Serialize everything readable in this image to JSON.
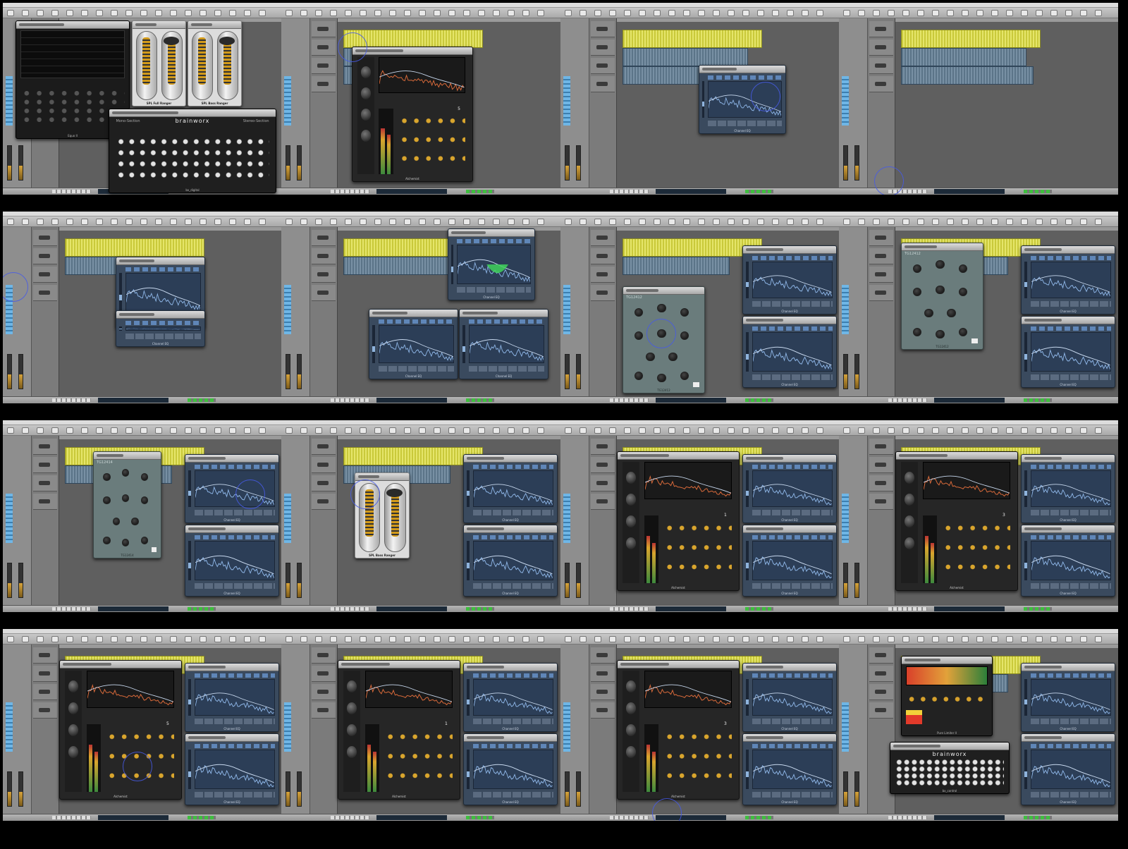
{
  "grid": {
    "columns": 4,
    "rows": 4
  },
  "frames": [
    {
      "id": "f1",
      "clips": [],
      "plugins": [
        {
          "kind": "eq3",
          "label": "Equo II",
          "box": "a"
        },
        {
          "kind": "spl",
          "label": "SPL Full Ranger",
          "box": "b"
        },
        {
          "kind": "spl",
          "label": "SPL Bass Ranger",
          "box": "c"
        },
        {
          "kind": "bwx",
          "label": "bx_digital",
          "brand": "brainworx",
          "left": "Mono-Section",
          "right": "Stereo-Section",
          "box": "d"
        }
      ],
      "cursor": null
    },
    {
      "id": "f2",
      "clips": [
        "y1",
        "b1",
        "b2"
      ],
      "plugins": [
        {
          "kind": "alch",
          "label": "Alchemist",
          "num": "5",
          "box": "e"
        }
      ],
      "cursor": "c2"
    },
    {
      "id": "f3",
      "clips": [
        "y2",
        "b3",
        "b4"
      ],
      "plugins": [
        {
          "kind": "chEQ",
          "label": "Channel EQ",
          "box": "f"
        }
      ],
      "cursor": "c3"
    },
    {
      "id": "f4",
      "clips": [
        "y2",
        "b3",
        "b4"
      ],
      "plugins": [],
      "cursor": "c4"
    },
    {
      "id": "f5",
      "clips": [
        "y3",
        "b5"
      ],
      "plugins": [
        {
          "kind": "chEQ",
          "label": "Channel EQ",
          "box": "g"
        },
        {
          "kind": "chEQ",
          "label": "Channel EQ",
          "box": "g2"
        }
      ],
      "cursor": "c5"
    },
    {
      "id": "f6",
      "clips": [
        "y3",
        "b5"
      ],
      "plugins": [
        {
          "kind": "chEQ",
          "label": "Channel EQ",
          "box": "h",
          "green": true
        },
        {
          "kind": "chEQ",
          "label": "Channel EQ",
          "box": "h2"
        },
        {
          "kind": "chEQ",
          "label": "Channel EQ",
          "box": "h3"
        }
      ],
      "cursor": null
    },
    {
      "id": "f7",
      "clips": [
        "y3",
        "b5"
      ],
      "plugins": [
        {
          "kind": "tg",
          "label": "TG12412",
          "box": "i"
        },
        {
          "kind": "chEQ",
          "label": "Channel EQ",
          "box": "r1"
        },
        {
          "kind": "chEQ",
          "label": "Channel EQ",
          "box": "r2"
        }
      ],
      "cursor": "c7"
    },
    {
      "id": "f8",
      "clips": [
        "y3",
        "b5"
      ],
      "plugins": [
        {
          "kind": "tg",
          "label": "TG12412",
          "box": "j"
        },
        {
          "kind": "chEQ",
          "label": "Channel EQ",
          "box": "r1"
        },
        {
          "kind": "chEQ",
          "label": "Channel EQ",
          "box": "r2"
        }
      ],
      "cursor": null
    },
    {
      "id": "f9",
      "clips": [
        "y3",
        "b5"
      ],
      "plugins": [
        {
          "kind": "tg",
          "label": "TG12414",
          "box": "k"
        },
        {
          "kind": "chEQ",
          "label": "Channel EQ",
          "box": "r1"
        },
        {
          "kind": "chEQ",
          "label": "Channel EQ",
          "box": "r2"
        }
      ],
      "cursor": "c9"
    },
    {
      "id": "f10",
      "clips": [
        "y3",
        "b5"
      ],
      "plugins": [
        {
          "kind": "spl",
          "label": "SPL Bass Ranger",
          "box": "l"
        },
        {
          "kind": "chEQ",
          "label": "Channel EQ",
          "box": "r1"
        },
        {
          "kind": "chEQ",
          "label": "Channel EQ",
          "box": "r2"
        }
      ],
      "cursor": "c10"
    },
    {
      "id": "f11",
      "clips": [
        "y3",
        "b5"
      ],
      "plugins": [
        {
          "kind": "alch",
          "label": "Alchemist",
          "num": "1",
          "box": "m"
        },
        {
          "kind": "chEQ",
          "label": "Channel EQ",
          "box": "r1"
        },
        {
          "kind": "chEQ",
          "label": "Channel EQ",
          "box": "r2"
        }
      ],
      "cursor": null
    },
    {
      "id": "f12",
      "clips": [
        "y3",
        "b5"
      ],
      "plugins": [
        {
          "kind": "alch",
          "label": "Alchemist",
          "num": "3",
          "box": "m"
        },
        {
          "kind": "chEQ",
          "label": "Channel EQ",
          "box": "r1"
        },
        {
          "kind": "chEQ",
          "label": "Channel EQ",
          "box": "r2"
        }
      ],
      "cursor": null
    },
    {
      "id": "f13",
      "clips": [
        "y3",
        "b5"
      ],
      "plugins": [
        {
          "kind": "alch",
          "label": "Alchemist",
          "num": "5",
          "box": "m"
        },
        {
          "kind": "chEQ",
          "label": "Channel EQ",
          "box": "r1"
        },
        {
          "kind": "chEQ",
          "label": "Channel EQ",
          "box": "r2"
        }
      ],
      "cursor": "c13"
    },
    {
      "id": "f14",
      "clips": [
        "y3",
        "b5"
      ],
      "plugins": [
        {
          "kind": "alch",
          "label": "Alchemist",
          "num": "1",
          "box": "m"
        },
        {
          "kind": "chEQ",
          "label": "Channel EQ",
          "box": "r1"
        },
        {
          "kind": "chEQ",
          "label": "Channel EQ",
          "box": "r2"
        }
      ],
      "cursor": null
    },
    {
      "id": "f15",
      "clips": [
        "y3",
        "b5"
      ],
      "plugins": [
        {
          "kind": "alch",
          "label": "Alchemist",
          "num": "3",
          "box": "m"
        },
        {
          "kind": "chEQ",
          "label": "Channel EQ",
          "box": "r1"
        },
        {
          "kind": "chEQ",
          "label": "Channel EQ",
          "box": "r2"
        }
      ],
      "cursor": "c15"
    },
    {
      "id": "f16",
      "clips": [
        "y3",
        "b5"
      ],
      "plugins": [
        {
          "kind": "pure",
          "label": "Pure Limiter II",
          "box": "n"
        },
        {
          "kind": "bwxc",
          "label": "bx_control",
          "brand": "brainworx",
          "box": "o"
        },
        {
          "kind": "chEQ",
          "label": "Channel EQ",
          "box": "r1"
        },
        {
          "kind": "chEQ",
          "label": "Channel EQ",
          "box": "r2"
        }
      ],
      "cursor": null
    }
  ]
}
